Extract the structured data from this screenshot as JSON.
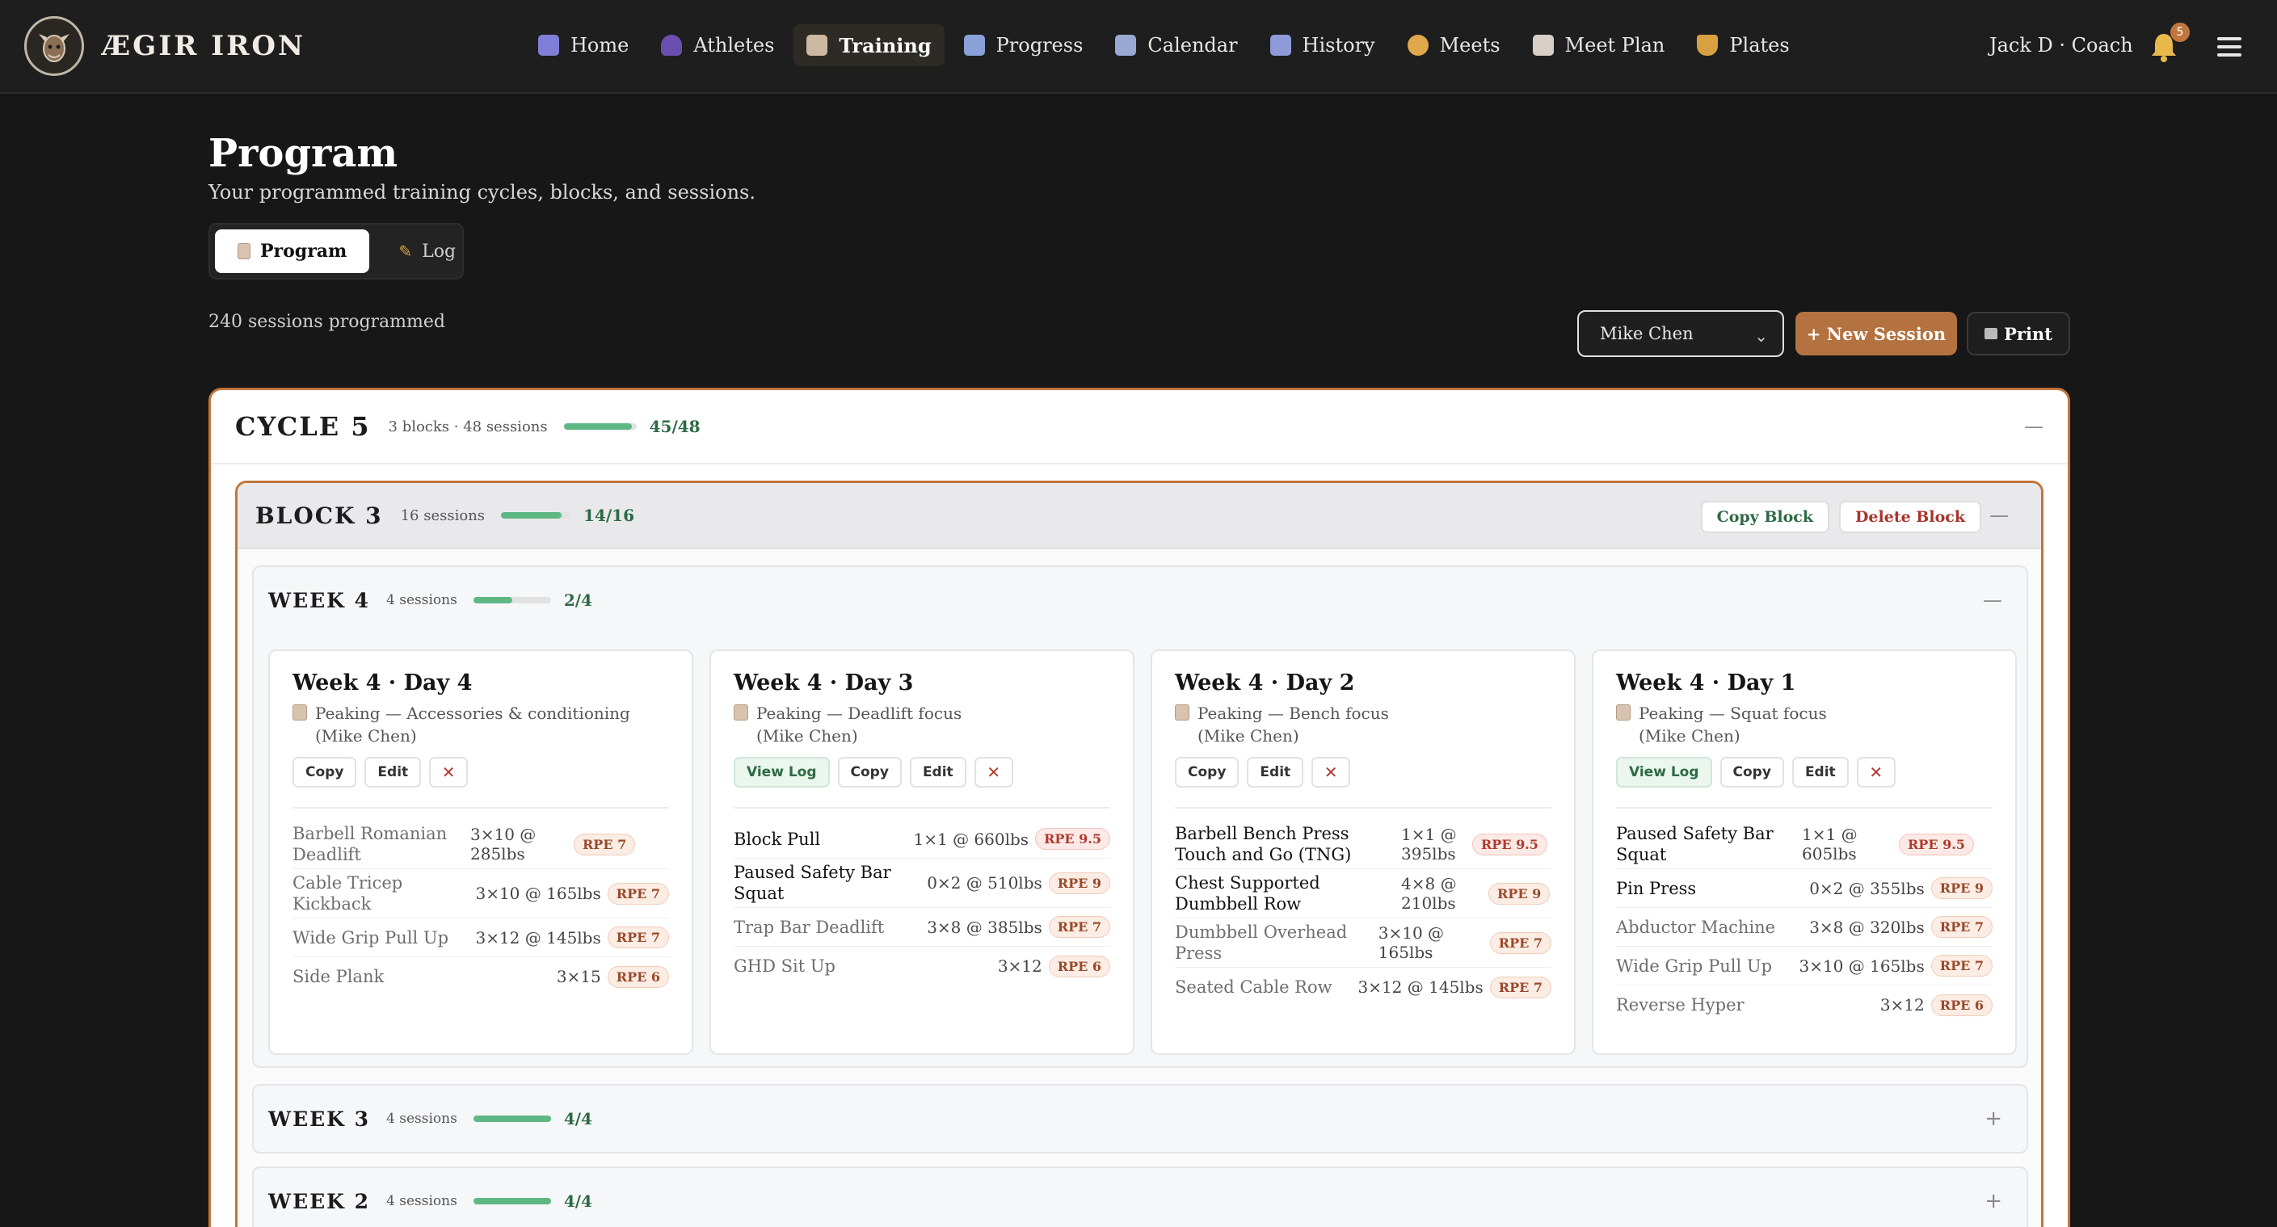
{
  "app": {
    "brand": "ÆGIR IRON",
    "user": "Jack D · Coach",
    "notifications": "5"
  },
  "nav": [
    {
      "label": "Home",
      "icon": "bar-chart-icon",
      "color": "#7f7fd8"
    },
    {
      "label": "Athletes",
      "icon": "users-icon",
      "color": "#6a4fb0"
    },
    {
      "label": "Training",
      "icon": "clipboard-icon",
      "color": "#cdb8a2"
    },
    {
      "label": "Progress",
      "icon": "line-chart-icon",
      "color": "#8aa0d8"
    },
    {
      "label": "Calendar",
      "icon": "calendar-icon",
      "color": "#9aa8d4"
    },
    {
      "label": "History",
      "icon": "calendar-grid-icon",
      "color": "#8f9ad8"
    },
    {
      "label": "Meets",
      "icon": "medal-icon",
      "color": "#e0a84a"
    },
    {
      "label": "Meet Plan",
      "icon": "document-icon",
      "color": "#d8d0c8"
    },
    {
      "label": "Plates",
      "icon": "dumbbell-icon",
      "color": "#d8a040"
    }
  ],
  "page": {
    "title": "Program",
    "subtitle": "Your programmed training cycles, blocks, and sessions.",
    "tabs": {
      "program": "Program",
      "log": "Log"
    },
    "sessions_count": "240 sessions programmed",
    "athlete": "Mike Chen",
    "new_session": "+ New Session",
    "print": "Print"
  },
  "cycle": {
    "title": "CYCLE 5",
    "meta": "3 blocks · 48 sessions",
    "progress": 0.9375,
    "frac": "45/48"
  },
  "block": {
    "title": "BLOCK 3",
    "meta": "16 sessions",
    "progress": 0.875,
    "frac": "14/16",
    "copy": "Copy Block",
    "delete": "Delete Block"
  },
  "weeks": [
    {
      "title": "WEEK 4",
      "meta": "4 sessions",
      "progress": 0.5,
      "frac": "2/4"
    },
    {
      "title": "WEEK 3",
      "meta": "4 sessions",
      "progress": 1.0,
      "frac": "4/4"
    },
    {
      "title": "WEEK 2",
      "meta": "4 sessions",
      "progress": 1.0,
      "frac": "4/4"
    }
  ],
  "cards": [
    {
      "title": "Week 4 · Day 4",
      "sub1": "Peaking — Accessories & conditioning",
      "sub2": "(Mike Chen)",
      "actions": {
        "view_log": "",
        "copy": "Copy",
        "edit": "Edit",
        "delete": "✕"
      },
      "exercises": [
        {
          "name": "Barbell Romanian Deadlift",
          "sets": "3×10 @ 285lbs",
          "rpe": "RPE 7"
        },
        {
          "name": "Cable Tricep Kickback",
          "sets": "3×10 @ 165lbs",
          "rpe": "RPE 7"
        },
        {
          "name": "Wide Grip Pull Up",
          "sets": "3×12 @ 145lbs",
          "rpe": "RPE 7"
        },
        {
          "name": "Side Plank",
          "sets": "3×15",
          "rpe": "RPE 6"
        }
      ]
    },
    {
      "title": "Week 4 · Day 3",
      "sub1": "Peaking — Deadlift focus",
      "sub2": "(Mike Chen)",
      "actions": {
        "view_log": "View Log",
        "copy": "Copy",
        "edit": "Edit",
        "delete": "✕"
      },
      "exercises": [
        {
          "name": "Block Pull",
          "sets": "1×1 @ 660lbs",
          "rpe": "RPE 9.5"
        },
        {
          "name": "Paused Safety Bar Squat",
          "sets": "0×2 @ 510lbs",
          "rpe": "RPE 9"
        },
        {
          "name": "Trap Bar Deadlift",
          "sets": "3×8 @ 385lbs",
          "rpe": "RPE 7"
        },
        {
          "name": "GHD Sit Up",
          "sets": "3×12",
          "rpe": "RPE 6"
        }
      ]
    },
    {
      "title": "Week 4 · Day 2",
      "sub1": "Peaking — Bench focus",
      "sub2": "(Mike Chen)",
      "actions": {
        "view_log": "",
        "copy": "Copy",
        "edit": "Edit",
        "delete": "✕"
      },
      "exercises": [
        {
          "name": "Barbell Bench Press Touch and Go (TNG)",
          "sets": "1×1 @ 395lbs",
          "rpe": "RPE 9.5"
        },
        {
          "name": "Chest Supported Dumbbell Row",
          "sets": "4×8 @ 210lbs",
          "rpe": "RPE 9"
        },
        {
          "name": "Dumbbell Overhead Press",
          "sets": "3×10 @ 165lbs",
          "rpe": "RPE 7"
        },
        {
          "name": "Seated Cable Row",
          "sets": "3×12 @ 145lbs",
          "rpe": "RPE 7"
        }
      ]
    },
    {
      "title": "Week 4 · Day 1",
      "sub1": "Peaking — Squat focus",
      "sub2": "(Mike Chen)",
      "actions": {
        "view_log": "View Log",
        "copy": "Copy",
        "edit": "Edit",
        "delete": "✕"
      },
      "exercises": [
        {
          "name": "Paused Safety Bar Squat",
          "sets": "1×1 @ 605lbs",
          "rpe": "RPE 9.5"
        },
        {
          "name": "Pin Press",
          "sets": "0×2 @ 355lbs",
          "rpe": "RPE 9"
        },
        {
          "name": "Abductor Machine",
          "sets": "3×8 @ 320lbs",
          "rpe": "RPE 7"
        },
        {
          "name": "Wide Grip Pull Up",
          "sets": "3×10 @ 165lbs",
          "rpe": "RPE 7"
        },
        {
          "name": "Reverse Hyper",
          "sets": "3×12",
          "rpe": "RPE 6"
        }
      ]
    }
  ]
}
